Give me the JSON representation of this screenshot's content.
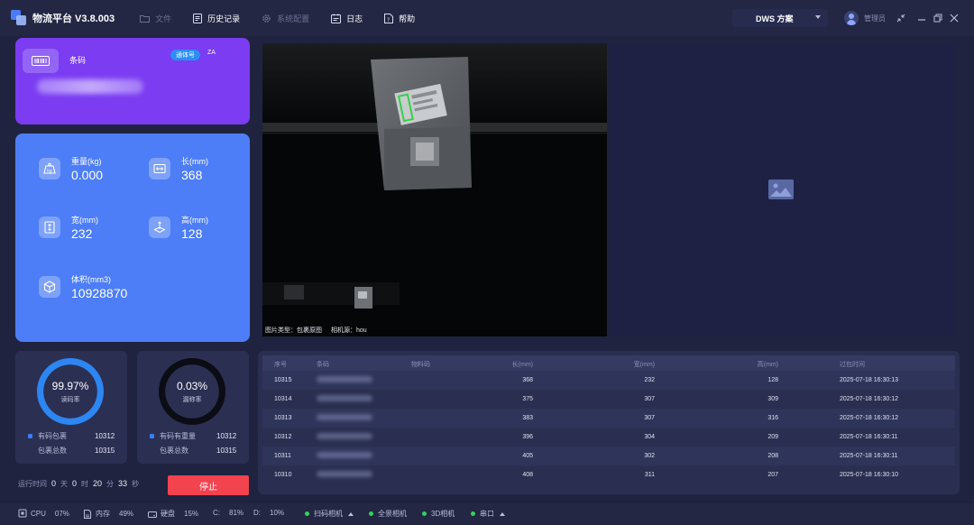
{
  "app": {
    "title": "物流平台 V3.8.003",
    "menu": [
      {
        "label": "文件",
        "icon": "folder-icon",
        "enabled": false
      },
      {
        "label": "历史记录",
        "icon": "history-icon",
        "enabled": true
      },
      {
        "label": "系统配置",
        "icon": "gear-icon",
        "enabled": false
      },
      {
        "label": "日志",
        "icon": "log-icon",
        "enabled": true
      },
      {
        "label": "帮助",
        "icon": "help-icon",
        "enabled": true
      }
    ],
    "scheme_label": "DWS 方案",
    "user_name": "管理员"
  },
  "barcode_card": {
    "label": "条码",
    "channel_tag": "通体号",
    "channel_code": "ZA"
  },
  "metrics": {
    "weight": {
      "label": "重量(kg)",
      "value": "0.000"
    },
    "length": {
      "label": "长(mm)",
      "value": "368"
    },
    "width": {
      "label": "宽(mm)",
      "value": "232"
    },
    "height": {
      "label": "高(mm)",
      "value": "128"
    },
    "volume": {
      "label": "体积(mm3)",
      "value": "10928870"
    }
  },
  "read_rate": {
    "value": "99.97%",
    "percent": 99.97,
    "label": "读码率",
    "row1_label": "有码包裹",
    "row1_value": "10312",
    "row2_label": "包裹总数",
    "row2_value": "10315"
  },
  "miss_rate": {
    "value": "0.03%",
    "percent": 0.03,
    "label": "漏称率",
    "row1_label": "有码有重量",
    "row1_value": "10312",
    "row2_label": "包裹总数",
    "row2_value": "10315"
  },
  "runtime": {
    "label": "运行时间",
    "days": "0",
    "days_unit": "天",
    "hours": "0",
    "hours_unit": "时",
    "minutes": "20",
    "minutes_unit": "分",
    "seconds": "33",
    "seconds_unit": "秒"
  },
  "stop_label": "停止",
  "camera": {
    "caption_type": "图片类型：包裹原图",
    "caption_source": "相机源：hou"
  },
  "table": {
    "headers": [
      "序号",
      "条码",
      "物料码",
      "长(mm)",
      "宽(mm)",
      "高(mm)",
      "过包时间"
    ],
    "rows": [
      {
        "id": "10315",
        "length": "368",
        "width": "232",
        "height": "128",
        "time": "2025-07-18 16:30:13"
      },
      {
        "id": "10314",
        "length": "375",
        "width": "307",
        "height": "309",
        "time": "2025-07-18 16:30:12"
      },
      {
        "id": "10313",
        "length": "383",
        "width": "307",
        "height": "316",
        "time": "2025-07-18 16:30:12"
      },
      {
        "id": "10312",
        "length": "396",
        "width": "304",
        "height": "209",
        "time": "2025-07-18 16:30:11"
      },
      {
        "id": "10311",
        "length": "405",
        "width": "302",
        "height": "208",
        "time": "2025-07-18 16:30:11"
      },
      {
        "id": "10310",
        "length": "408",
        "width": "311",
        "height": "207",
        "time": "2025-07-18 16:30:10"
      }
    ]
  },
  "status": {
    "cpu_label": "CPU",
    "cpu_value": "07%",
    "mem_label": "内存",
    "mem_value": "49%",
    "disk_label": "硬盘",
    "disk_value": "15%",
    "c_label": "C:",
    "c_value": "81%",
    "d_label": "D:",
    "d_value": "10%",
    "devices": [
      {
        "label": "扫码相机",
        "dropdown": true
      },
      {
        "label": "全景相机",
        "dropdown": false
      },
      {
        "label": "3D相机",
        "dropdown": false
      },
      {
        "label": "串口",
        "dropdown": true
      }
    ],
    "device_status_color": "#30d35c"
  },
  "colors": {
    "barcode_card": "#7b3cf2",
    "metrics_card": "#4d7ef7",
    "read_ring": "#2d86f2",
    "miss_ring": "#0b0c14",
    "stop_button": "#f2434f",
    "channel_tag": "#2b8ef5"
  }
}
